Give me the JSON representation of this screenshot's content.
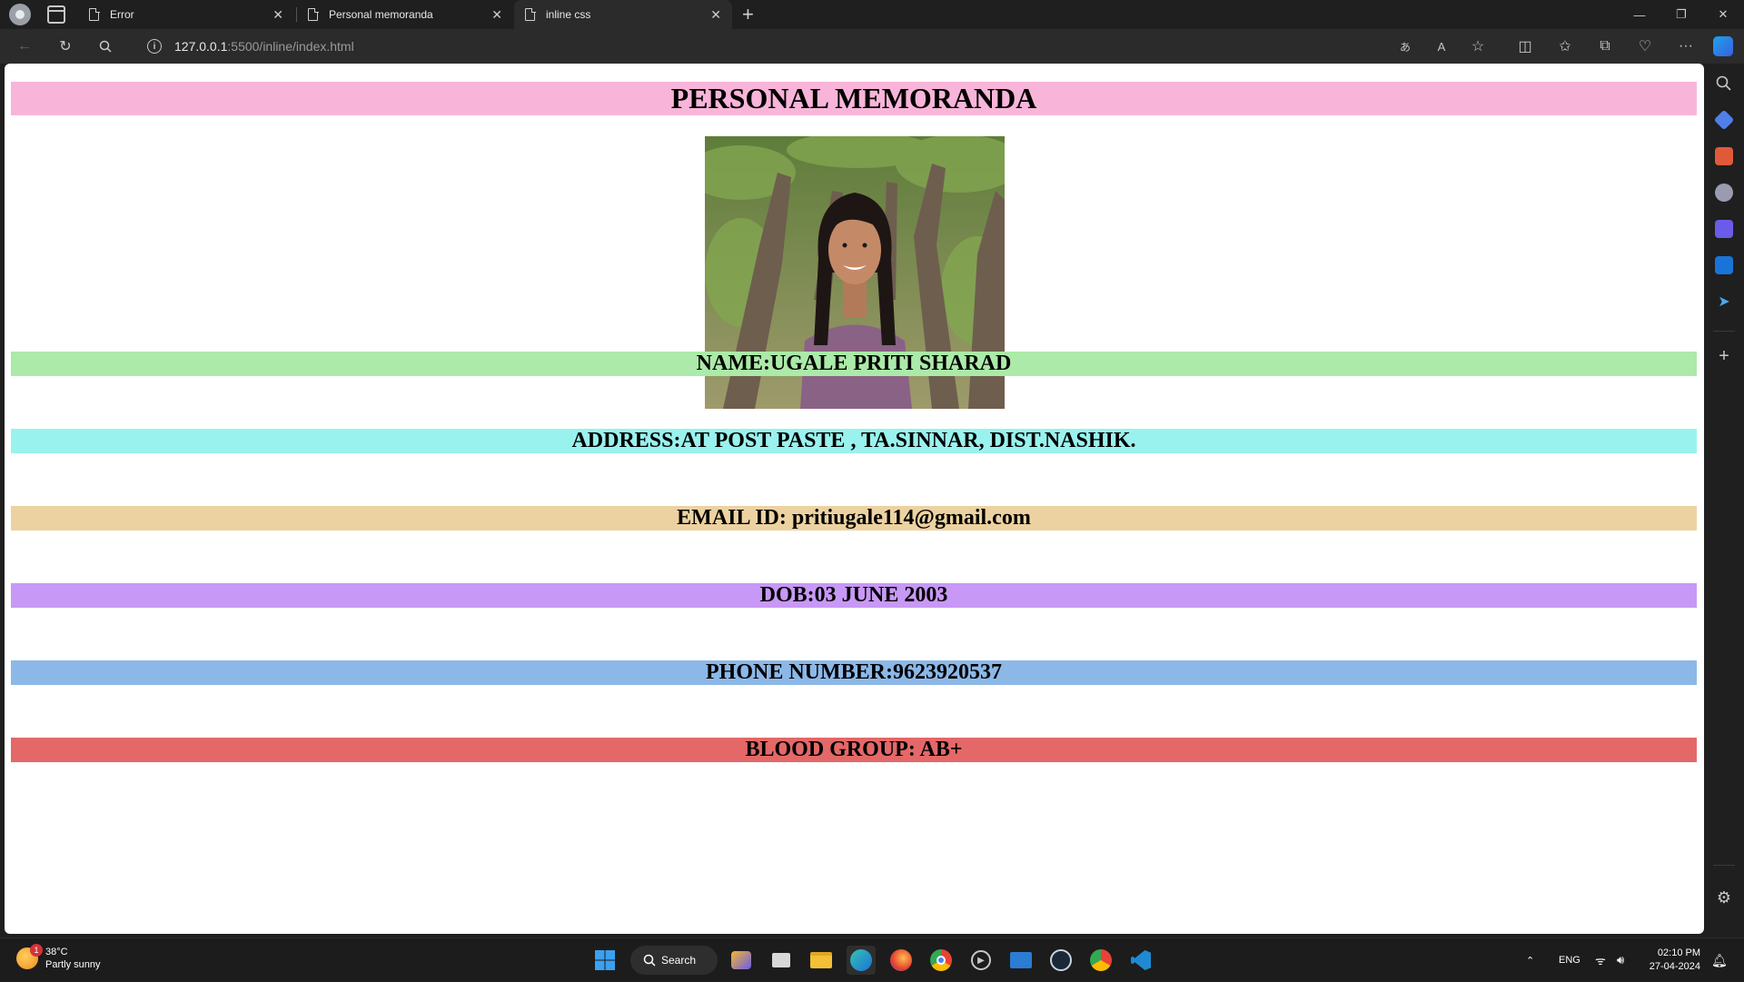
{
  "browser": {
    "tabs": [
      {
        "title": "Error",
        "active": false
      },
      {
        "title": "Personal memoranda",
        "active": false
      },
      {
        "title": "inline css",
        "active": true
      }
    ],
    "url_host": "127.0.0.1",
    "url_rest": ":5500/inline/index.html"
  },
  "page": {
    "title": "PERSONAL MEMORANDA",
    "rows": [
      {
        "text": "NAME:UGALE PRITI SHARAD",
        "color": "#abeaa8"
      },
      {
        "text": "ADDRESS:AT POST PASTE , TA.SINNAR, DIST.NASHIK.",
        "color": "#9af2ee"
      },
      {
        "text": "EMAIL ID: pritiugale114@gmail.com",
        "color": "#edd2a1"
      },
      {
        "text": "DOB:03 JUNE 2003",
        "color": "#c898f6"
      },
      {
        "text": "PHONE NUMBER:9623920537",
        "color": "#8cb8e8"
      },
      {
        "text": "BLOOD GROUP: AB+",
        "color": "#e46868"
      }
    ],
    "title_color": "#f8b5d9"
  },
  "taskbar": {
    "weather_temp": "38°C",
    "weather_desc": "Partly sunny",
    "weather_badge": "1",
    "search_label": "Search",
    "lang": "ENG",
    "time": "02:10 PM",
    "date": "27-04-2024"
  }
}
